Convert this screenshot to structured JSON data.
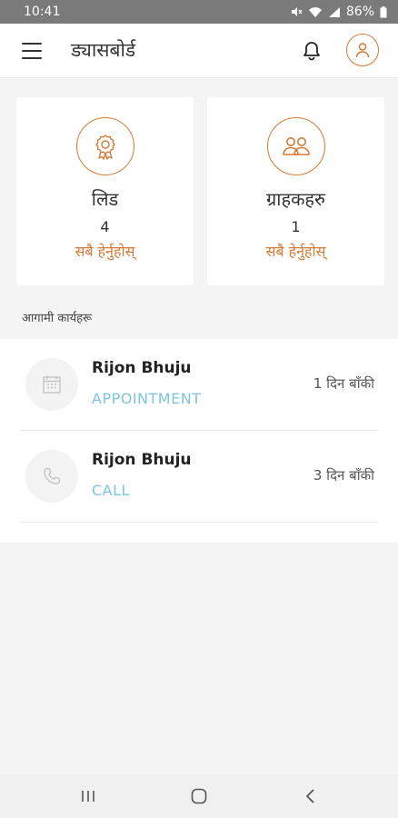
{
  "status": {
    "time": "10:41",
    "battery": "86%"
  },
  "header": {
    "title": "ड्यासबोर्ड"
  },
  "cards": [
    {
      "title": "लिड",
      "count": "4",
      "link": "सबै हेर्नुहोस्",
      "icon": "award-icon"
    },
    {
      "title": "ग्राहकहरु",
      "count": "1",
      "link": "सबै हेर्नुहोस्",
      "icon": "users-icon"
    }
  ],
  "upcoming": {
    "heading": "आगामी कार्यहरू",
    "tasks": [
      {
        "name": "Rijon Bhuju",
        "type": "APPOINTMENT",
        "days": "1 दिन बाँकी",
        "icon": "calendar-icon"
      },
      {
        "name": "Rijon Bhuju",
        "type": "CALL",
        "days": "3 दिन बाँकी",
        "icon": "phone-icon"
      }
    ]
  },
  "colors": {
    "accent": "#d47a36",
    "task_type": "#7fc4dd",
    "status_bar": "#7a7a7a"
  }
}
